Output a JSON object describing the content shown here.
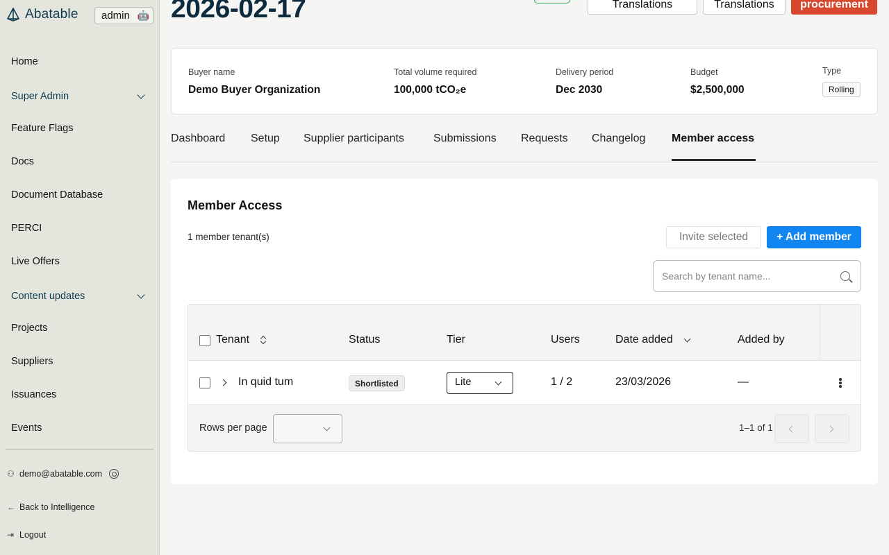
{
  "sidebar": {
    "logo": "Abatable",
    "admin_label": "admin",
    "items": [
      {
        "label": "Home"
      },
      {
        "label": "Super Admin"
      },
      {
        "label": "Feature Flags"
      },
      {
        "label": "Docs"
      },
      {
        "label": "Document Database"
      },
      {
        "label": "PERCI"
      },
      {
        "label": "Live Offers"
      },
      {
        "label": "Content updates"
      },
      {
        "label": "Projects"
      },
      {
        "label": "Suppliers"
      },
      {
        "label": "Issuances"
      },
      {
        "label": "Events"
      }
    ],
    "user_email": "demo@abatable.com",
    "back_link": "Back to Intelligence",
    "logout": "Logout"
  },
  "header": {
    "date_title": "2026-02-17",
    "buttons": [
      "Translations",
      "Translations",
      "procurement"
    ]
  },
  "info": {
    "buyer_label": "Buyer name",
    "buyer_value": "Demo Buyer Organization",
    "volume_label": "Total volume required",
    "volume_value": "100,000 tCO₂e",
    "delivery_label": "Delivery period",
    "delivery_value": "Dec 2030",
    "budget_label": "Budget",
    "budget_value": "$2,500,000",
    "type_label": "Type",
    "type_value": "Rolling"
  },
  "tabs": [
    "Dashboard",
    "Setup",
    "Supplier participants",
    "Submissions",
    "Requests",
    "Changelog",
    "Member access"
  ],
  "member_access": {
    "title": "Member Access",
    "count_text": "1 member tenant(s)",
    "invite_label": "Invite selected",
    "add_label": "+ Add member",
    "search_placeholder": "Search by tenant name...",
    "columns": [
      "Tenant",
      "Status",
      "Tier",
      "Users",
      "Date added",
      "Added by"
    ],
    "rows": [
      {
        "tenant": "In quid tum",
        "status": "Shortlisted",
        "tier": "Lite",
        "users": "1 / 2",
        "date_added": "23/03/2026",
        "added_by": "—"
      }
    ],
    "rows_per_page_label": "Rows per page",
    "page_info": "1–1 of 1"
  }
}
